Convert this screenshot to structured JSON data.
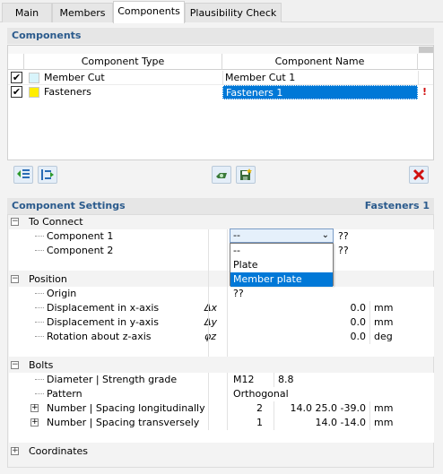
{
  "tabs": [
    {
      "label": "Main"
    },
    {
      "label": "Members"
    },
    {
      "label": "Components"
    },
    {
      "label": "Plausibility Check"
    }
  ],
  "components": {
    "title": "Components",
    "columns": [
      "Component Type",
      "Component Name"
    ],
    "rows": [
      {
        "checked": true,
        "type": "Member Cut",
        "name": "Member Cut 1",
        "color": "#d8f4fb",
        "selected": false,
        "mark": ""
      },
      {
        "checked": true,
        "type": "Fasteners",
        "name": "Fasteners 1",
        "color": "#ffee00",
        "selected": true,
        "mark": "!"
      }
    ]
  },
  "settings": {
    "title": "Component Settings",
    "current": "Fasteners 1",
    "to_connect": {
      "label": "To Connect",
      "component1_label": "Component 1",
      "component1_value": "--",
      "component1_extra": "??",
      "component2_label": "Component 2",
      "component2_extra": "??",
      "options": [
        "--",
        "Plate",
        "Member plate"
      ],
      "selected_option": "Member plate"
    },
    "position": {
      "label": "Position",
      "origin_label": "Origin",
      "origin_value": "??",
      "dx_label": "Displacement in x-axis",
      "dx_sym": "Δx",
      "dx_value": "0.0",
      "dx_unit": "mm",
      "dy_label": "Displacement in y-axis",
      "dy_sym": "Δy",
      "dy_value": "0.0",
      "dy_unit": "mm",
      "rz_label": "Rotation about z-axis",
      "rz_sym": "φz",
      "rz_value": "0.0",
      "rz_unit": "deg"
    },
    "bolts": {
      "label": "Bolts",
      "diameter_label": "Diameter | Strength grade",
      "diameter": "M12",
      "grade": "8.8",
      "pattern_label": "Pattern",
      "pattern": "Orthogonal",
      "long_label": "Number | Spacing longitudinally",
      "long_count": "2",
      "long_spacing": "14.0 25.0 -39.0",
      "long_unit": "mm",
      "trans_label": "Number | Spacing transversely",
      "trans_count": "1",
      "trans_spacing": "14.0 -14.0",
      "trans_unit": "mm"
    },
    "coordinates": {
      "label": "Coordinates"
    }
  },
  "icons": {
    "toolbar_left": [
      "move-up-icon",
      "move-down-icon"
    ],
    "toolbar_mid": [
      "eye-show-icon",
      "save-favorite-icon"
    ],
    "toolbar_right": [
      "delete-icon"
    ]
  },
  "colors": {
    "accent": "#2a5a8c",
    "selection": "#0078d7",
    "delete": "#d01010"
  }
}
